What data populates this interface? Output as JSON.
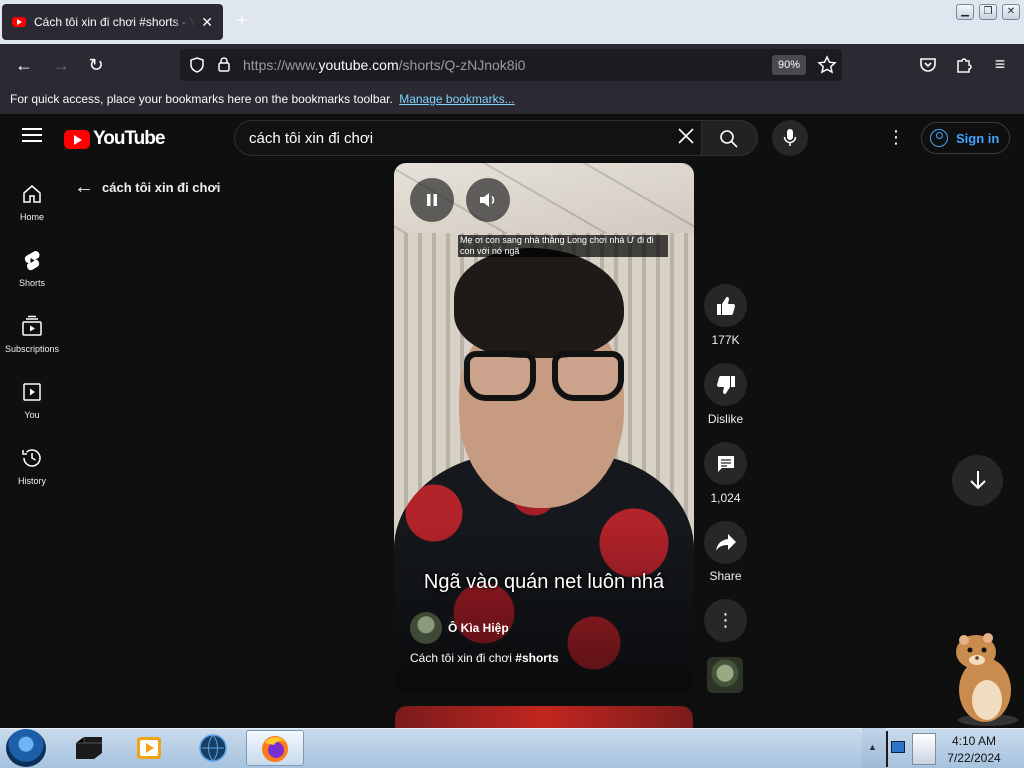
{
  "browser": {
    "tab_title": "Cách tôi xin đi chơi #shorts - YouTube",
    "new_tab": "+",
    "url_prefix": "https://www.",
    "url_domain": "youtube.com",
    "url_path": "/shorts/Q-zNJnok8i0",
    "zoom": "90%",
    "bookmarks_text": "For quick access, place your bookmarks here on the bookmarks toolbar.",
    "bookmarks_link": "Manage bookmarks..."
  },
  "youtube": {
    "logo_text": "YouTube",
    "search_value": "cách tôi xin đi chơi",
    "signin_label": "Sign in",
    "sidebar": [
      {
        "label": "Home",
        "icon": "home-icon"
      },
      {
        "label": "Shorts",
        "icon": "shorts-icon"
      },
      {
        "label": "Subscriptions",
        "icon": "subscriptions-icon"
      },
      {
        "label": "You",
        "icon": "you-icon"
      },
      {
        "label": "History",
        "icon": "history-icon"
      }
    ],
    "back_label": "cách tôi xin đi chơi",
    "video": {
      "caption_top": "Mẹ ơi con sang nhà thằng Long chơi nhá Ừ đi đi con với nó ngã",
      "caption_main": "Ngã vào quán net luôn nhá",
      "channel": "Ô Kìa Hiệp",
      "title_text": "Cách tôi xin đi chơi",
      "title_tag": "#shorts"
    },
    "actions": {
      "like_count": "177K",
      "dislike_label": "Dislike",
      "comment_count": "1,024",
      "share_label": "Share"
    }
  },
  "taskbar": {
    "time": "4:10 AM",
    "date": "7/22/2024"
  },
  "colors": {
    "youtube_red": "#ff0000",
    "link_blue": "#3ea6ff",
    "bg": "#0f0f0f"
  }
}
